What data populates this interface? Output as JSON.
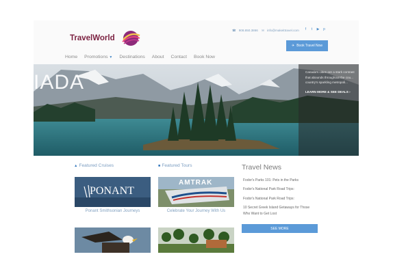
{
  "logo": {
    "text": "TravelWorld"
  },
  "contact": {
    "phone": "908.850.3866",
    "email": "info@makeittravel.com",
    "phone_icon": "phone-icon",
    "email_icon": "envelope-icon"
  },
  "social": [
    {
      "icon": "facebook-icon",
      "glyph": "f"
    },
    {
      "icon": "twitter-icon",
      "glyph": "t"
    },
    {
      "icon": "youtube-icon",
      "glyph": "▶"
    },
    {
      "icon": "pinterest-icon",
      "glyph": "p"
    }
  ],
  "header": {
    "book_label": "Book Travel Now",
    "book_icon": "plane-icon"
  },
  "nav": [
    "Home",
    "Promotions",
    "Destinations",
    "About",
    "Contact",
    "Book Now"
  ],
  "hero": {
    "title": "IADA",
    "text_lines": [
      "Canada's cities are a stark contrast",
      "that abounds throughout the cou...",
      "country's sparkling metropoli..."
    ],
    "link": "LEARN MORE & SEE DEALS ›"
  },
  "featured_cruises": {
    "label": "Featured Cruises",
    "cards": [
      {
        "caption": "Ponant Smithsonian Journeys",
        "logo_text": "PONANT"
      },
      {
        "caption": ""
      }
    ]
  },
  "featured_tours": {
    "label": "Featured Tours",
    "cards": [
      {
        "caption": "Celebrate Your Journey With Us",
        "logo_text": "AMTRAK"
      },
      {
        "caption": ""
      }
    ]
  },
  "news": {
    "title": "Travel News",
    "items": [
      "Fodor's Parks 101: Pets in the Parks",
      "Fodor's National Park Road Trips:",
      "Fodor's National Park Road Trips:",
      "10 Secret Greek Island Getaways for Those",
      "Who Want to Get Lost"
    ],
    "see_more": "SEE MORE"
  },
  "colors": {
    "accent": "#5b9ad8",
    "brand": "#7a1f3f",
    "link": "#7f9fbf"
  }
}
